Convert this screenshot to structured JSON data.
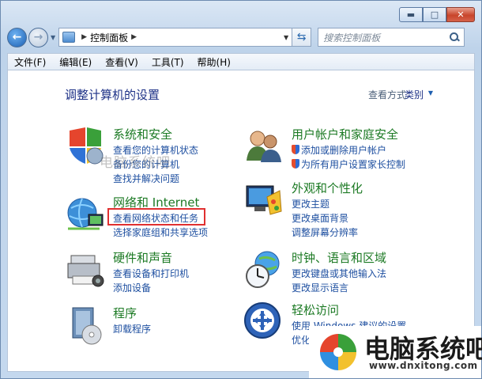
{
  "window": {
    "caption": {
      "minimize": "▬",
      "maximize": "□",
      "close": "✕"
    }
  },
  "toolbar": {
    "back_icon": "←",
    "forward_icon": "→",
    "address_path": "控制面板",
    "search_placeholder": "搜索控制面板"
  },
  "menubar": {
    "items": [
      "文件(F)",
      "编辑(E)",
      "查看(V)",
      "工具(T)",
      "帮助(H)"
    ]
  },
  "main": {
    "title": "调整计算机的设置",
    "view_by_label": "查看方式:",
    "view_by_value": "类别",
    "categories": [
      {
        "title": "系统和安全",
        "links": [
          "查看您的计算机状态",
          "备份您的计算机",
          "查找并解决问题"
        ],
        "icon": "system-security-icon"
      },
      {
        "title": "网络和 Internet",
        "links": [
          "查看网络状态和任务",
          "选择家庭组和共享选项"
        ],
        "icon": "network-icon"
      },
      {
        "title": "硬件和声音",
        "links": [
          "查看设备和打印机",
          "添加设备"
        ],
        "icon": "hardware-sound-icon"
      },
      {
        "title": "程序",
        "links": [
          "卸载程序"
        ],
        "icon": "programs-icon"
      },
      {
        "title": "用户帐户和家庭安全",
        "links": [
          "添加或删除用户帐户",
          "为所有用户设置家长控制"
        ],
        "icon": "user-accounts-icon"
      },
      {
        "title": "外观和个性化",
        "links": [
          "更改主题",
          "更改桌面背景",
          "调整屏幕分辨率"
        ],
        "icon": "appearance-icon"
      },
      {
        "title": "时钟、语言和区域",
        "links": [
          "更改键盘或其他输入法",
          "更改显示语言"
        ],
        "icon": "clock-region-icon"
      },
      {
        "title": "轻松访问",
        "links": [
          "使用 Windows 建议的设置",
          "优化视频显示"
        ],
        "icon": "ease-of-access-icon"
      }
    ]
  },
  "watermark": {
    "top": "电脑系统吧",
    "brand": "电脑系统吧",
    "url": "www.dnxitong.com"
  },
  "colors": {
    "highlight_box": "#e03030",
    "link": "#1e4fa0",
    "category_title": "#1c7a24"
  }
}
